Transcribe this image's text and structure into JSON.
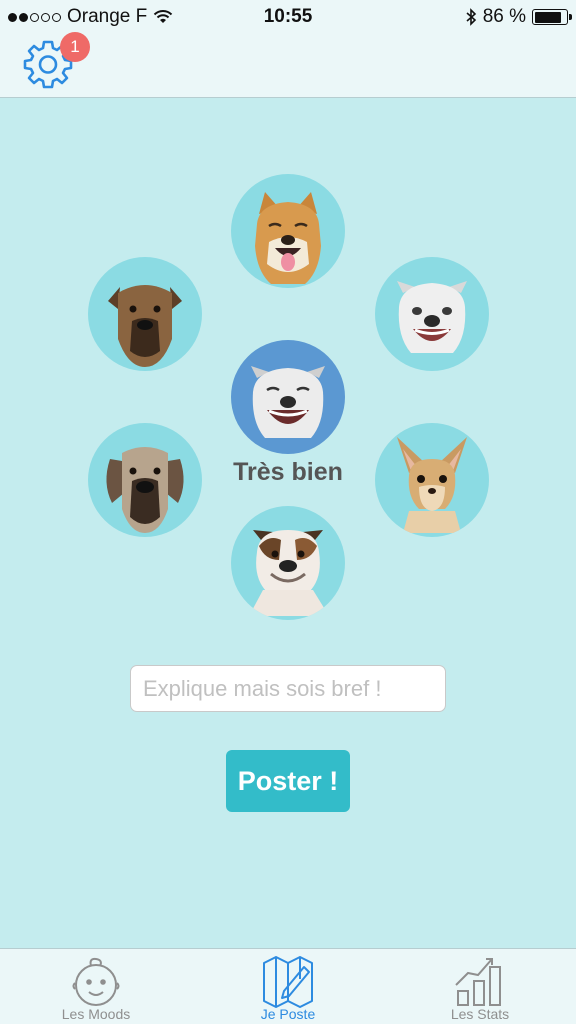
{
  "status": {
    "carrier": "Orange F",
    "time": "10:55",
    "battery": "86 %",
    "battery_level": 0.86,
    "signal_bars_filled": 2,
    "signal_bars_total": 5
  },
  "header": {
    "settings_icon": "gear-icon",
    "notification_count": "1"
  },
  "moods": {
    "selected_label": "Très bien",
    "items": [
      {
        "id": "shiba",
        "icon": "shiba-dog-face"
      },
      {
        "id": "pitbull",
        "icon": "pitbull-dog-face"
      },
      {
        "id": "boxer",
        "icon": "boxer-dog-face"
      },
      {
        "id": "staffy",
        "icon": "staffy-dog-face",
        "selected": true
      },
      {
        "id": "great-dane",
        "icon": "great-dane-dog-face"
      },
      {
        "id": "chihuahua",
        "icon": "chihuahua-dog-face"
      },
      {
        "id": "bulldog",
        "icon": "bulldog-dog-face"
      }
    ]
  },
  "form": {
    "explain_placeholder": "Explique mais sois bref !",
    "explain_value": "",
    "submit_label": "Poster !"
  },
  "tabs": [
    {
      "label": "Les Moods",
      "icon": "baby-face-icon",
      "active": false
    },
    {
      "label": "Je Poste",
      "icon": "map-pen-icon",
      "active": true
    },
    {
      "label": "Les Stats",
      "icon": "bar-chart-icon",
      "active": false
    }
  ],
  "colors": {
    "background": "#c4ecee",
    "mood_circle": "#8bdbe3",
    "mood_selected": "#5b98d2",
    "accent": "#33bcc9",
    "active_tab": "#2d8be0",
    "badge": "#ef6a67"
  }
}
